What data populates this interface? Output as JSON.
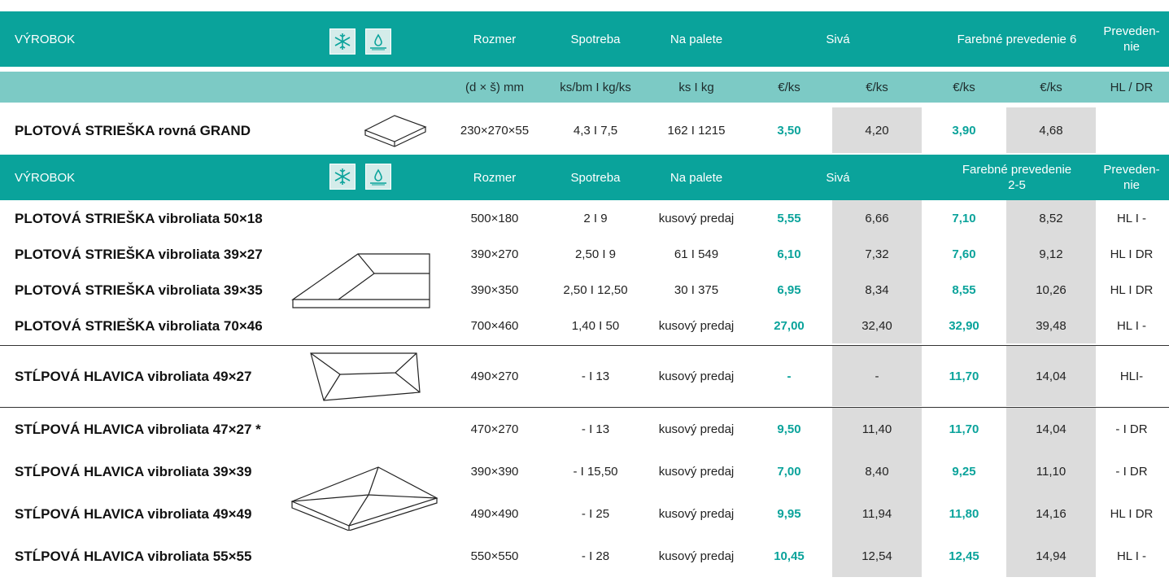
{
  "colors": {
    "accent": "#0aa39b",
    "subheader": "#7ccac5",
    "price_alt_bg": "#dcdcdc"
  },
  "icons": [
    "snowflake-icon",
    "water-drop-icon"
  ],
  "header1": {
    "product": "VÝROBOK",
    "size": "Rozmer",
    "consumption": "Spotreba",
    "pallet": "Na palete",
    "grey": "Sivá",
    "color": "Farebné prevedenie 6",
    "variant_line1": "Preveden-",
    "variant_line2": "nie"
  },
  "units": {
    "size": "(d × š) mm",
    "consumption": "ks/bm I kg/ks",
    "pallet": "ks I kg",
    "p1": "€/ks",
    "p2": "€/ks",
    "p3": "€/ks",
    "p4": "€/ks",
    "variant": "HL / DR"
  },
  "grand": {
    "name": "PLOTOVÁ STRIEŠKA rovná GRAND",
    "size": "230×270×55",
    "consumption": "4,3 I 7,5",
    "pallet": "162 I 1215",
    "p1": "3,50",
    "p2": "4,20",
    "p3": "3,90",
    "p4": "4,68",
    "variant": ""
  },
  "header2": {
    "product": "VÝROBOK",
    "size": "Rozmer",
    "consumption": "Spotreba",
    "pallet": "Na palete",
    "grey": "Sivá",
    "color_line1": "Farebné prevedenie",
    "color_line2": "2-5",
    "variant_line1": "Preveden-",
    "variant_line2": "nie"
  },
  "rows": [
    {
      "name": "PLOTOVÁ STRIEŠKA vibroliata 50×18",
      "size": "500×180",
      "consumption": "2 I 9",
      "pallet": "kusový predaj",
      "p1": "5,55",
      "p2": "6,66",
      "p3": "7,10",
      "p4": "8,52",
      "variant": "HL I -"
    },
    {
      "name": "PLOTOVÁ STRIEŠKA vibroliata 39×27",
      "size": "390×270",
      "consumption": "2,50 I 9",
      "pallet": "61 I 549",
      "p1": "6,10",
      "p2": "7,32",
      "p3": "7,60",
      "p4": "9,12",
      "variant": "HL I DR"
    },
    {
      "name": "PLOTOVÁ STRIEŠKA vibroliata 39×35",
      "size": "390×350",
      "consumption": "2,50 I 12,50",
      "pallet": "30 I 375",
      "p1": "6,95",
      "p2": "8,34",
      "p3": "8,55",
      "p4": "10,26",
      "variant": "HL I DR"
    },
    {
      "name": "PLOTOVÁ STRIEŠKA vibroliata 70×46",
      "size": "700×460",
      "consumption": "1,40 I 50",
      "pallet": "kusový predaj",
      "p1": "27,00",
      "p2": "32,40",
      "p3": "32,90",
      "p4": "39,48",
      "variant": "HL I -"
    },
    {
      "name": "STĹPOVÁ HLAVICA vibroliata 49×27",
      "size": "490×270",
      "consumption": "- I 13",
      "pallet": "kusový predaj",
      "p1": "-",
      "p2": "-",
      "p3": "11,70",
      "p4": "14,04",
      "variant": "HLI-"
    },
    {
      "name": "STĹPOVÁ HLAVICA vibroliata 47×27 *",
      "size": "470×270",
      "consumption": "- I 13",
      "pallet": "kusový predaj",
      "p1": "9,50",
      "p2": "11,40",
      "p3": "11,70",
      "p4": "14,04",
      "variant": "- I DR"
    },
    {
      "name": "STĹPOVÁ HLAVICA vibroliata 39×39",
      "size": "390×390",
      "consumption": "- I 15,50",
      "pallet": "kusový predaj",
      "p1": "7,00",
      "p2": "8,40",
      "p3": "9,25",
      "p4": "11,10",
      "variant": "- I DR"
    },
    {
      "name": "STĹPOVÁ HLAVICA vibroliata 49×49",
      "size": "490×490",
      "consumption": "- I 25",
      "pallet": "kusový predaj",
      "p1": "9,95",
      "p2": "11,94",
      "p3": "11,80",
      "p4": "14,16",
      "variant": "HL I DR"
    },
    {
      "name": "STĹPOVÁ HLAVICA vibroliata 55×55",
      "size": "550×550",
      "consumption": "- I 28",
      "pallet": "kusový predaj",
      "p1": "10,45",
      "p2": "12,54",
      "p3": "12,45",
      "p4": "14,94",
      "variant": "HL I -"
    }
  ]
}
